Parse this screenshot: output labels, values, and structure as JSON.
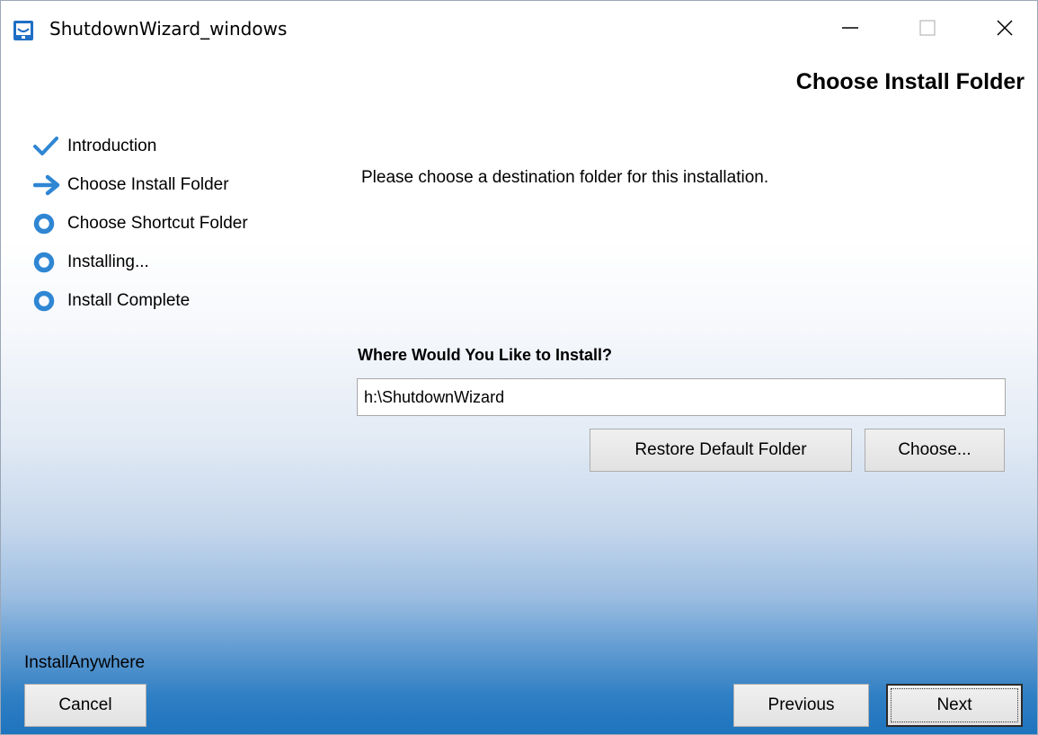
{
  "window": {
    "title": "ShutdownWizard_windows",
    "app_icon": "installanywhere-app-icon",
    "controls": {
      "minimize_icon": "minimize-icon",
      "maximize_icon": "maximize-icon",
      "close_icon": "close-icon"
    }
  },
  "header": {
    "title": "Choose Install Folder"
  },
  "steps": [
    {
      "label": "Introduction",
      "state": "done",
      "icon": "checkmark-icon"
    },
    {
      "label": "Choose Install Folder",
      "state": "current",
      "icon": "arrow-right-icon"
    },
    {
      "label": "Choose Shortcut Folder",
      "state": "pending",
      "icon": "circle-icon"
    },
    {
      "label": "Installing...",
      "state": "pending",
      "icon": "circle-icon"
    },
    {
      "label": "Install Complete",
      "state": "pending",
      "icon": "circle-icon"
    }
  ],
  "main": {
    "intro": "Please choose a destination folder for this installation.",
    "where_label": "Where Would You Like to Install?",
    "install_path": "h:\\ShutdownWizard",
    "restore_button": "Restore Default Folder",
    "choose_button": "Choose..."
  },
  "footer": {
    "brand": "InstallAnywhere",
    "cancel_button": "Cancel",
    "previous_button": "Previous",
    "next_button": "Next"
  },
  "colors": {
    "accent": "#2f86d3",
    "gradient_bottom": "#1e74be"
  }
}
